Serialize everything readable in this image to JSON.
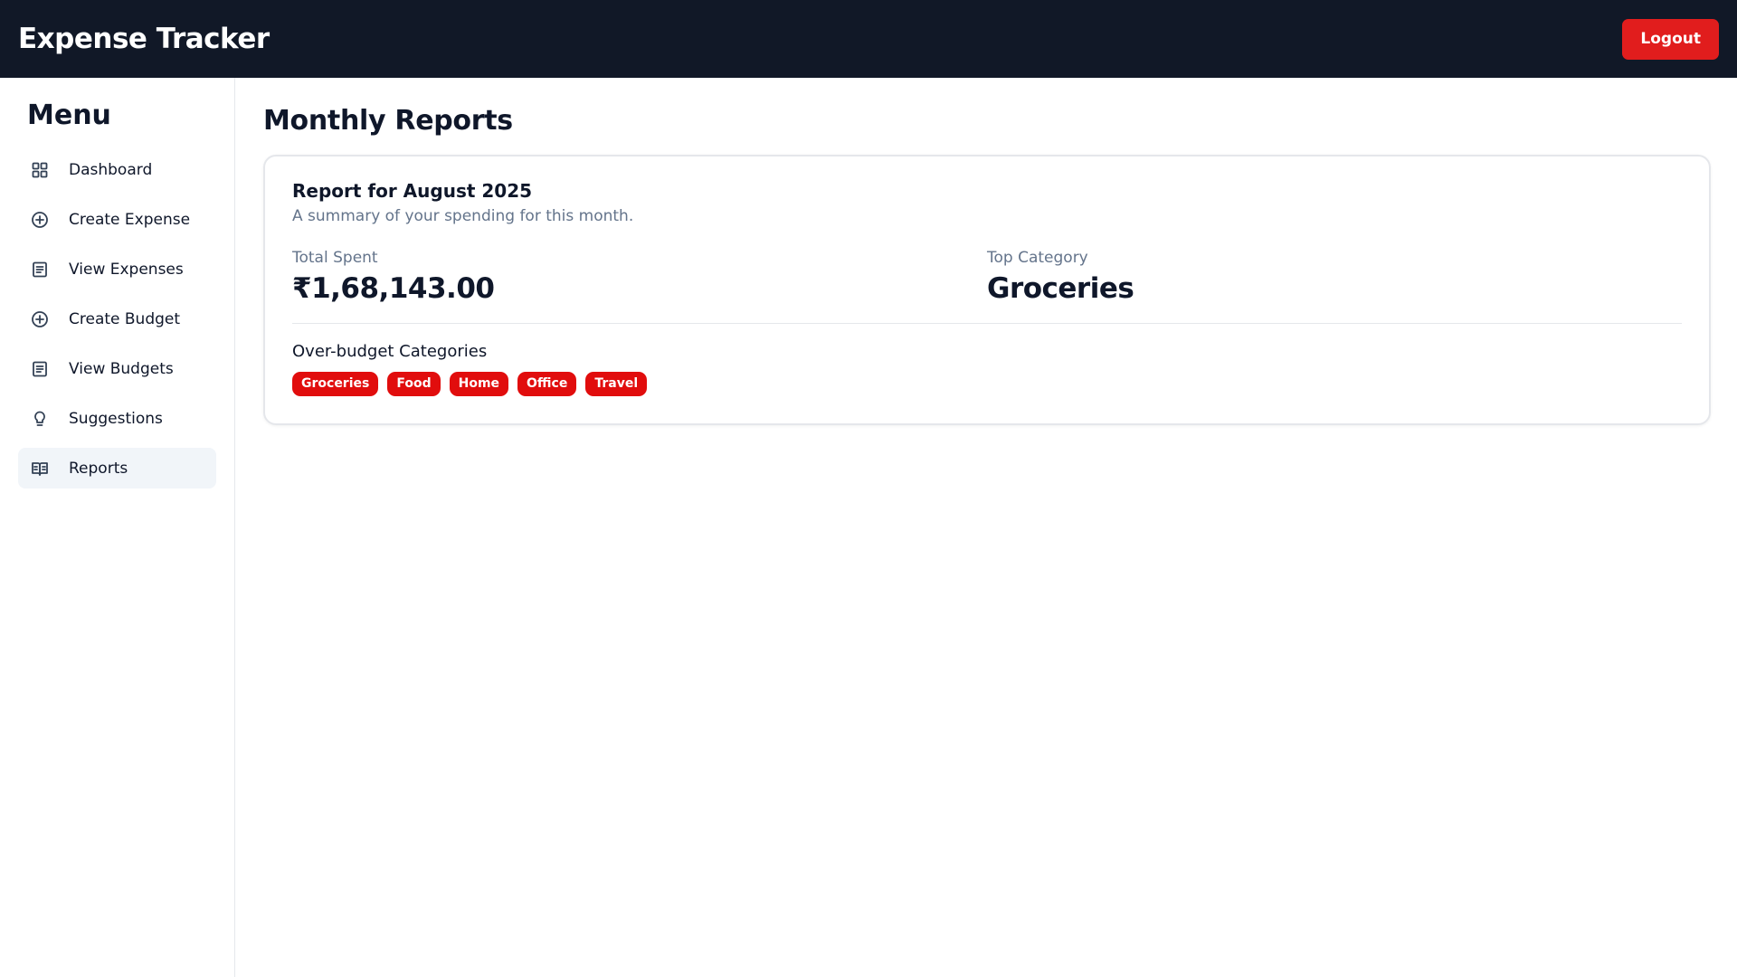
{
  "header": {
    "title": "Expense Tracker",
    "logout_label": "Logout"
  },
  "sidebar": {
    "title": "Menu",
    "items": [
      {
        "label": "Dashboard",
        "icon": "dashboard-grid-icon"
      },
      {
        "label": "Create Expense",
        "icon": "plus-circle-icon"
      },
      {
        "label": "View Expenses",
        "icon": "list-doc-icon"
      },
      {
        "label": "Create Budget",
        "icon": "plus-circle-icon"
      },
      {
        "label": "View Budgets",
        "icon": "list-doc-icon"
      },
      {
        "label": "Suggestions",
        "icon": "lightbulb-icon"
      },
      {
        "label": "Reports",
        "icon": "open-book-icon",
        "active": true
      }
    ]
  },
  "main": {
    "page_title": "Monthly Reports",
    "report": {
      "title": "Report for August 2025",
      "subtitle": "A summary of your spending for this month.",
      "total_spent_label": "Total Spent",
      "total_spent_value": "₹1,68,143.00",
      "top_category_label": "Top Category",
      "top_category_value": "Groceries",
      "over_budget_title": "Over-budget Categories",
      "over_budget_tags": [
        "Groceries",
        "Food",
        "Home",
        "Office",
        "Travel"
      ]
    }
  },
  "colors": {
    "topbar_bg": "#111827",
    "accent_red": "#e11d1d",
    "active_nav_bg": "#f1f5f9",
    "muted_text": "#64748b"
  }
}
